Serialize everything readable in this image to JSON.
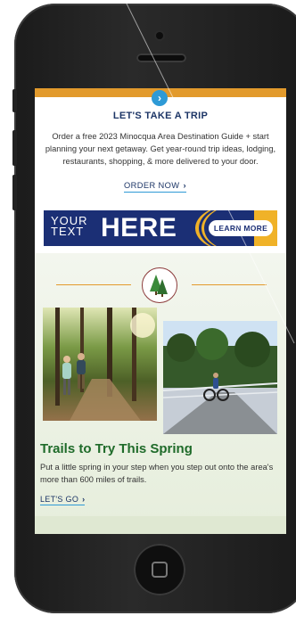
{
  "header": {
    "arrow_icon": "chevron-down-icon"
  },
  "trip": {
    "headline": "LET'S TAKE A TRIP",
    "body": "Order a free 2023 Minocqua Area Destination Guide + start planning your next getaway. Get year-round trip ideas, lodging, restaurants, shopping, & more delivered to your door.",
    "cta_label": "ORDER NOW",
    "cta_chevron": "›"
  },
  "ad": {
    "your_line1": "YOUR",
    "your_line2": "TEXT",
    "big_word": "HERE",
    "button_label": "LEARN MORE",
    "colors": {
      "navy": "#1b2f75",
      "gold": "#f0b228"
    }
  },
  "divider": {
    "icon": "pine-trees-icon"
  },
  "trails": {
    "title": "Trails to Try This Spring",
    "body": "Put a little spring in your step when you step out onto the area's more than 600 miles of trails.",
    "cta_label": "LET'S GO",
    "cta_chevron": "›"
  },
  "colors": {
    "accent_orange": "#e29a2c",
    "link_blue": "#2e9ad6",
    "heading_navy": "#1c3566",
    "trail_green": "#1f6b2a"
  }
}
